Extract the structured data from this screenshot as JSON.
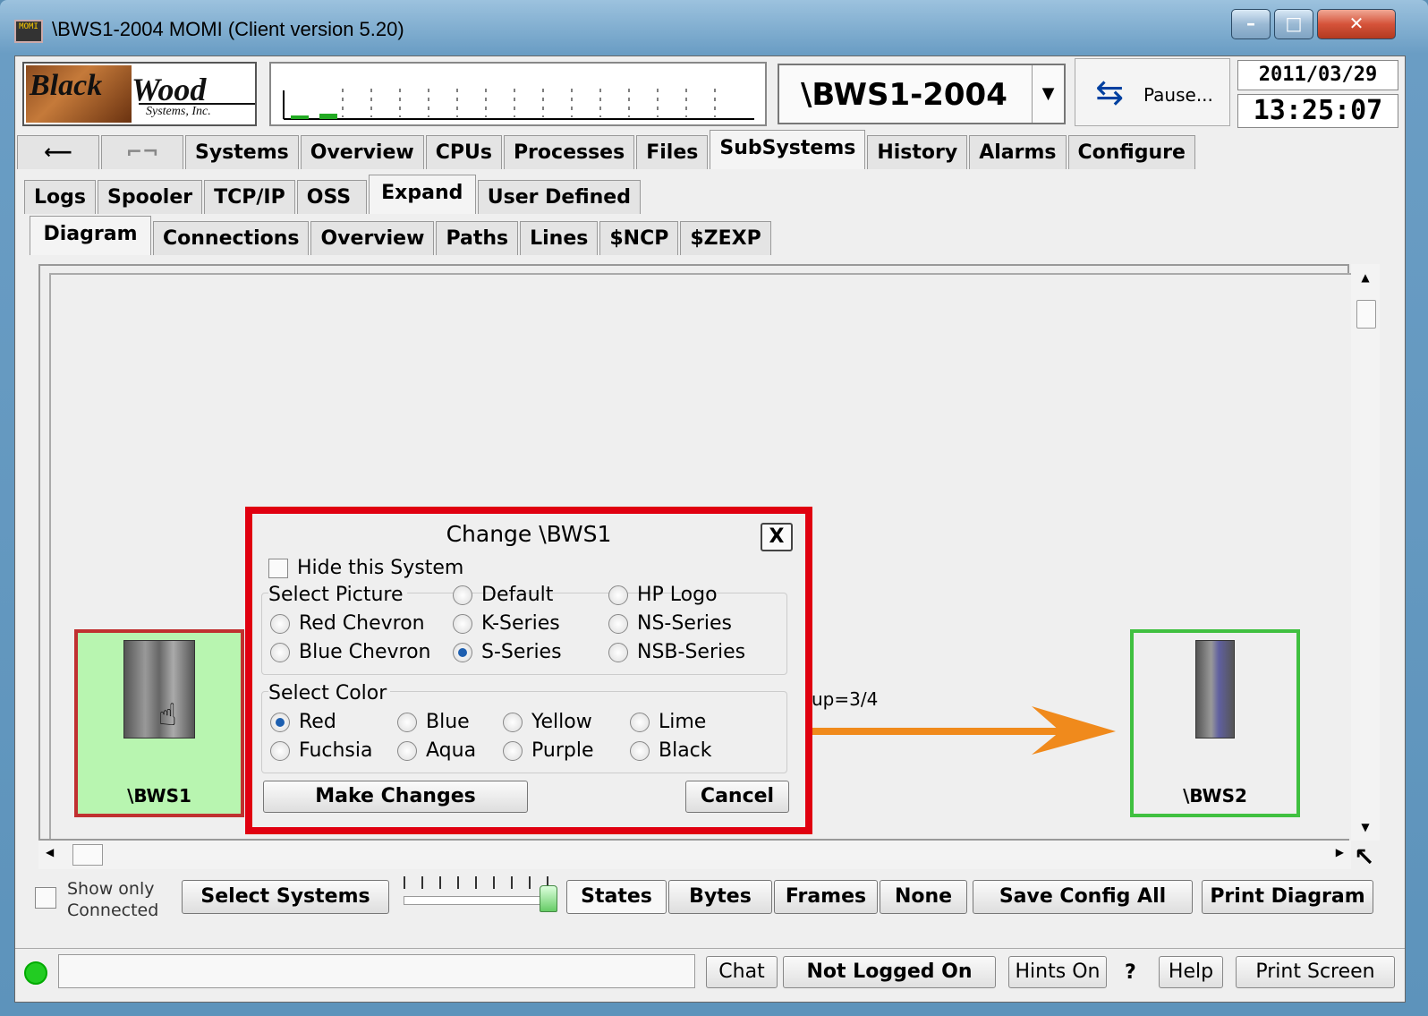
{
  "window": {
    "title": "\\BWS1-2004 MOMI (Client version 5.20)",
    "icon": "MOMI"
  },
  "header": {
    "logo_text1": "Black",
    "logo_text2": "Wood",
    "logo_text3": "Systems, Inc.",
    "system": "\\BWS1-2004",
    "pause_label": "Pause...",
    "date": "2011/03/29",
    "time": "13:25:07"
  },
  "tabs_main": [
    "Systems",
    "Overview",
    "CPUs",
    "Processes",
    "Files",
    "SubSystems",
    "History",
    "Alarms",
    "Configure"
  ],
  "tabs_main_selected": "SubSystems",
  "tabs_sub": [
    "Logs",
    "Spooler",
    "TCP/IP",
    "OSS",
    "Expand",
    "User Defined"
  ],
  "tabs_sub_selected": "Expand",
  "tabs_third": [
    "Diagram",
    "Connections",
    "Overview",
    "Paths",
    "Lines",
    "$NCP",
    "$ZEXP"
  ],
  "tabs_third_selected": "Diagram",
  "diagram": {
    "node1": "\\BWS1",
    "node2": "\\BWS2",
    "link_label": "up=3/4",
    "node1_color": "#b8f5b0",
    "node2_color": "#40d040",
    "link_color": "#f08a1c"
  },
  "dialog": {
    "title": "Change \\BWS1",
    "close": "X",
    "hide_label": "Hide this System",
    "picture_group": "Select Picture",
    "pictures": [
      "Default",
      "HP Logo",
      "Red Chevron",
      "K-Series",
      "NS-Series",
      "Blue Chevron",
      "S-Series",
      "NSB-Series"
    ],
    "picture_selected": "S-Series",
    "color_group": "Select Color",
    "colors": [
      "Red",
      "Blue",
      "Yellow",
      "Lime",
      "Fuchsia",
      "Aqua",
      "Purple",
      "Black"
    ],
    "color_selected": "Red",
    "make": "Make Changes",
    "cancel": "Cancel"
  },
  "bottom": {
    "show_only": "Show only",
    "connected": "Connected",
    "select_systems": "Select Systems",
    "states": "States",
    "bytes": "Bytes",
    "frames": "Frames",
    "none": "None",
    "save": "Save Config All",
    "print": "Print Diagram"
  },
  "status": {
    "chat": "Chat",
    "login": "Not Logged On",
    "hints": "Hints On",
    "q": "?",
    "help": "Help",
    "print_screen": "Print Screen",
    "status_color": "#22cc22"
  }
}
